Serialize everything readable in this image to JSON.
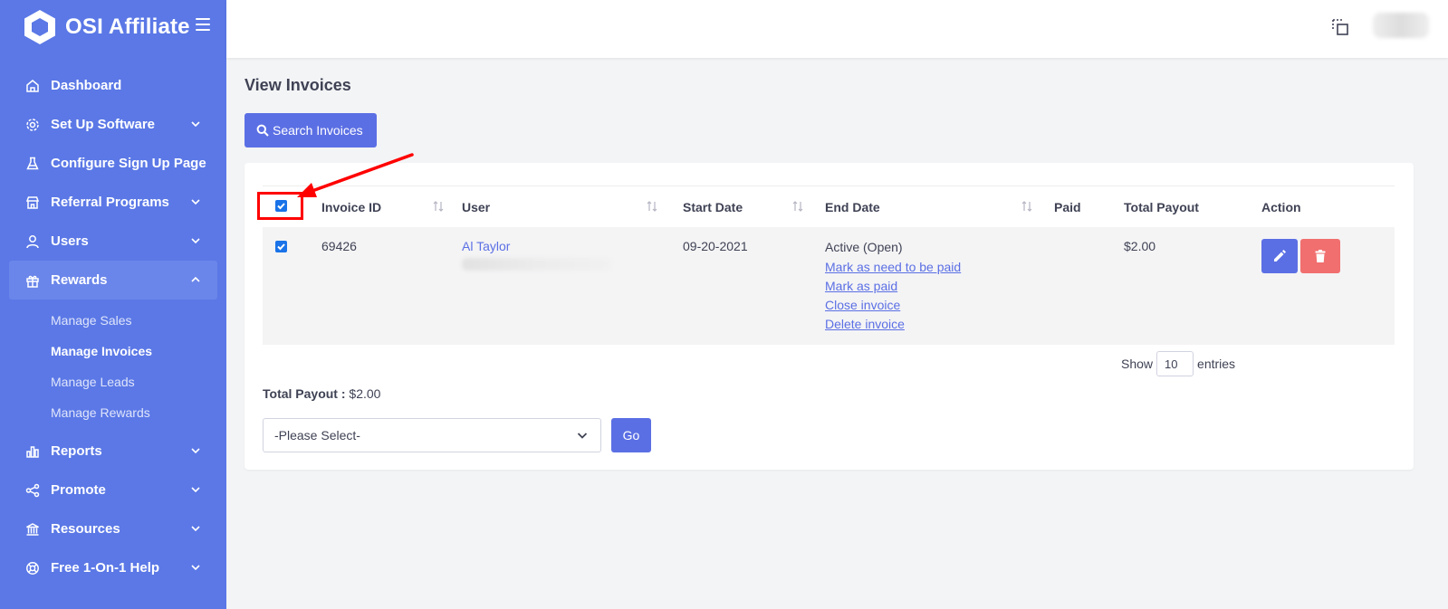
{
  "brand": {
    "name": "OSI Affiliate"
  },
  "sidebar": {
    "items": [
      {
        "label": "Dashboard",
        "icon": "home-icon",
        "has_chevron": false
      },
      {
        "label": "Set Up Software",
        "icon": "gear-icon",
        "has_chevron": true
      },
      {
        "label": "Configure Sign Up Page",
        "icon": "flask-icon",
        "has_chevron": false
      },
      {
        "label": "Referral Programs",
        "icon": "store-icon",
        "has_chevron": true
      },
      {
        "label": "Users",
        "icon": "user-icon",
        "has_chevron": true
      },
      {
        "label": "Rewards",
        "icon": "gift-icon",
        "has_chevron": true,
        "expanded": true
      },
      {
        "label": "Reports",
        "icon": "bar-chart-icon",
        "has_chevron": true
      },
      {
        "label": "Promote",
        "icon": "share-icon",
        "has_chevron": true
      },
      {
        "label": "Resources",
        "icon": "bank-icon",
        "has_chevron": true
      },
      {
        "label": "Free 1-On-1 Help",
        "icon": "lifebuoy-icon",
        "has_chevron": true
      }
    ],
    "rewards_sub": [
      {
        "label": "Manage Sales",
        "current": false
      },
      {
        "label": "Manage Invoices",
        "current": true
      },
      {
        "label": "Manage Leads",
        "current": false
      },
      {
        "label": "Manage Rewards",
        "current": false
      }
    ]
  },
  "page": {
    "title": "View Invoices",
    "search_button": "Search Invoices"
  },
  "table": {
    "columns": [
      "Invoice ID",
      "User",
      "Start Date",
      "End Date",
      "Paid",
      "Total Payout",
      "Action"
    ],
    "rows": [
      {
        "checked": true,
        "invoice_id": "69426",
        "user": "Al Taylor",
        "start_date": "09-20-2021",
        "end_date_status": "Active (Open)",
        "end_date_links": [
          "Mark as need to be paid",
          "Mark as paid",
          "Close invoice",
          "Delete invoice"
        ],
        "paid": "",
        "total_payout": "$2.00"
      }
    ],
    "select_all_checked": true
  },
  "pagination": {
    "show_label": "Show",
    "entries_value": "10",
    "entries_label": "entries"
  },
  "summary": {
    "total_payout_label": "Total Payout :",
    "total_payout_value": "$2.00"
  },
  "bulk_action": {
    "selected": "-Please Select-",
    "go_label": "Go"
  },
  "colors": {
    "sidebar": "#5b78e6",
    "primary": "#5b6fe4",
    "danger": "#f16f6f",
    "annotation": "#ff0000"
  }
}
